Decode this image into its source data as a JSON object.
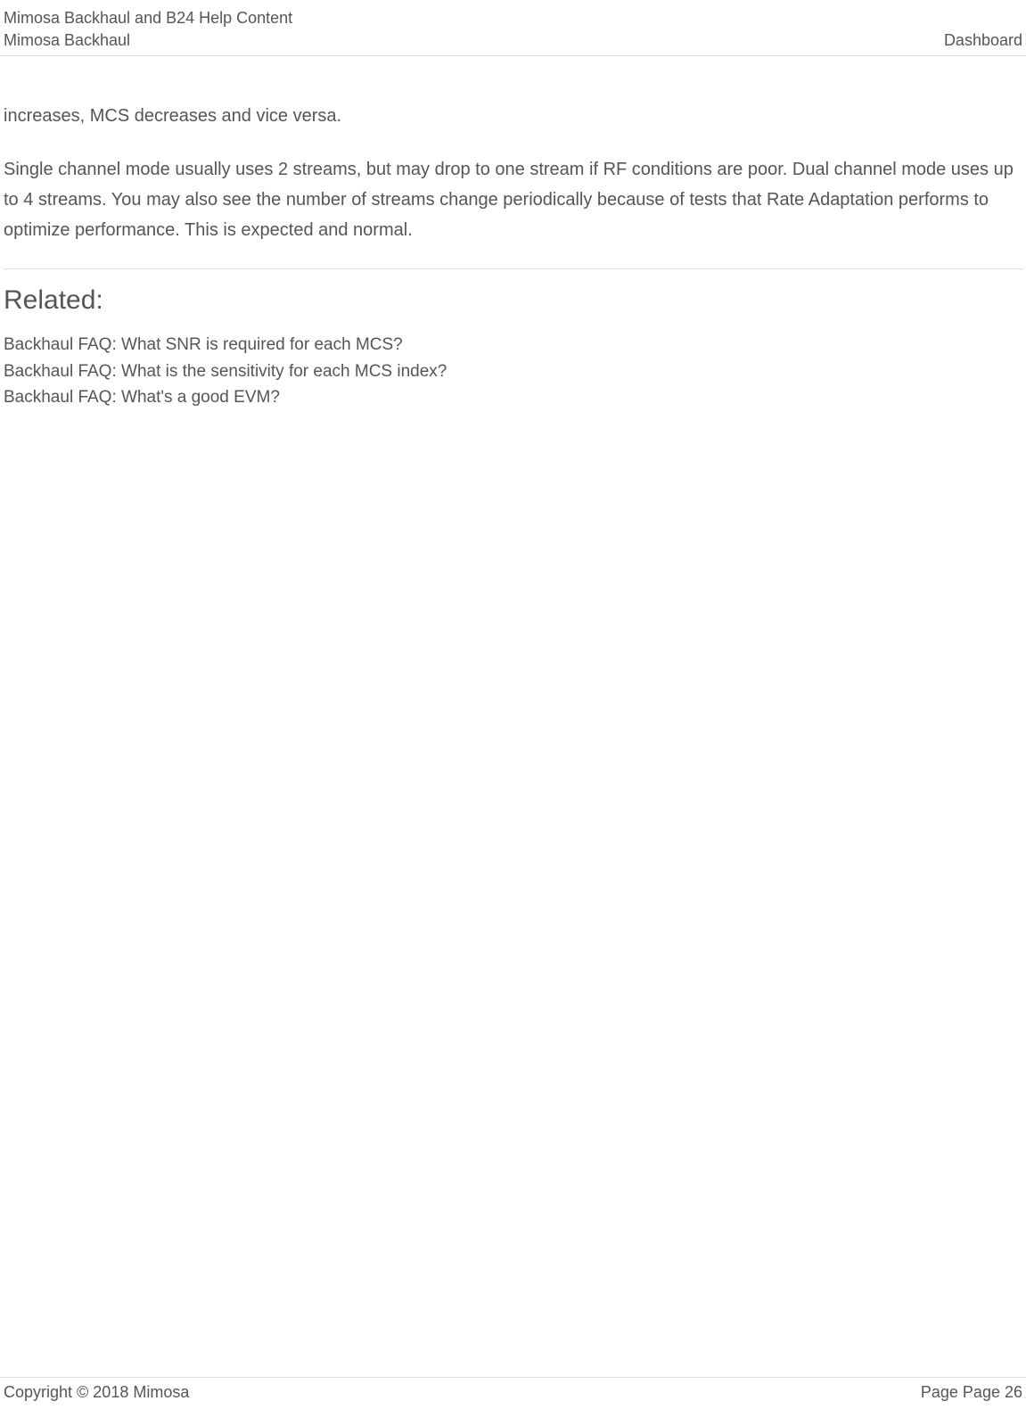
{
  "header": {
    "title": "Mimosa Backhaul and B24 Help Content",
    "subtitle": "Mimosa Backhaul",
    "section": "Dashboard"
  },
  "content": {
    "paragraph1": "increases, MCS decreases and vice versa.",
    "paragraph2": "Single channel mode usually uses 2 streams, but may drop to one stream if RF conditions are poor. Dual channel mode uses up to 4 streams.  You may also see the number of streams change periodically because of tests that Rate Adaptation performs to optimize performance. This is expected and normal."
  },
  "related": {
    "heading": "Related:",
    "items": [
      "Backhaul FAQ: What SNR is required for each MCS?",
      "Backhaul FAQ: What is the sensitivity for each MCS index?",
      "Backhaul  FAQ: What's a good EVM?"
    ]
  },
  "footer": {
    "copyright": "Copyright © 2018 Mimosa",
    "page": "Page Page 26"
  }
}
